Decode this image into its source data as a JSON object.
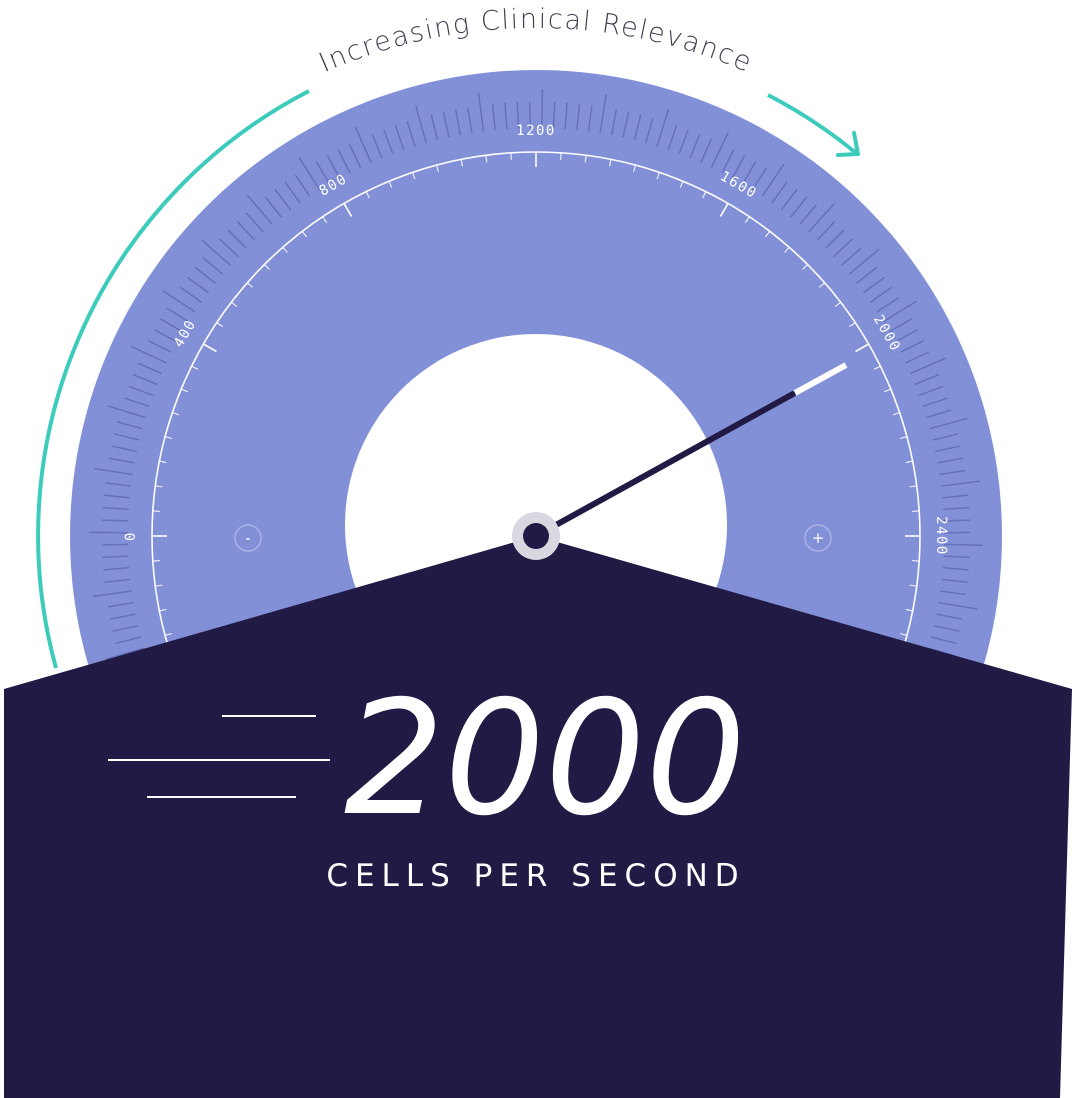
{
  "gauge": {
    "caption": "Increasing Clinical Relevance",
    "scale_min": 0,
    "scale_max": 2400,
    "major_tick_labels": [
      "0",
      "400",
      "800",
      "1200",
      "1600",
      "2000",
      "2400"
    ],
    "value": 2000,
    "display_value": "2000",
    "unit_label": "CELLS PER SECOND",
    "decrease_label": "-",
    "increase_label": "+"
  },
  "colors": {
    "dial": "#8290d7",
    "dial_tick": "#6570bd",
    "scale_line": "#ffffff",
    "hub_ring": "#d8d8e0",
    "needle": "#211a44",
    "panel": "#211a44",
    "arrow": "#3dcbbc",
    "caption": "#3f3f52",
    "panel_text": "#ffffff"
  }
}
